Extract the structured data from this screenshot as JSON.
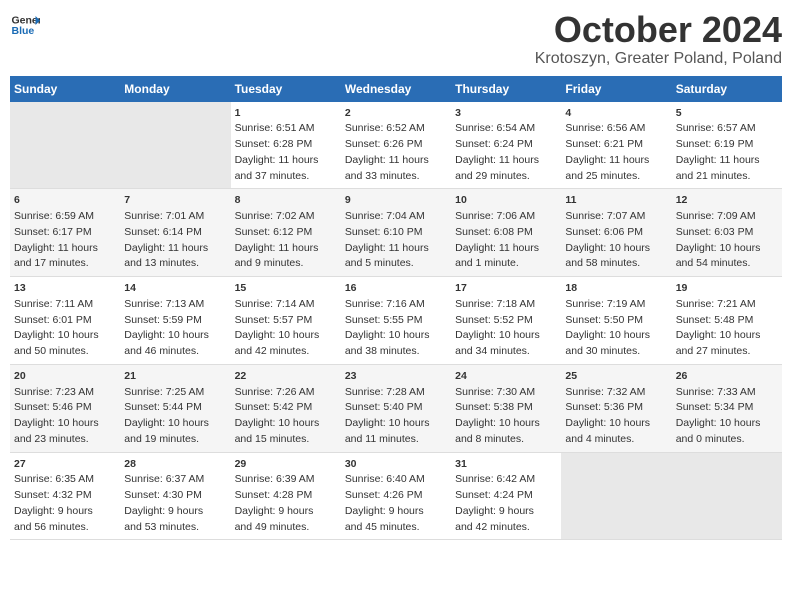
{
  "logo": {
    "general": "General",
    "blue": "Blue"
  },
  "header": {
    "month": "October 2024",
    "location": "Krotoszyn, Greater Poland, Poland"
  },
  "weekdays": [
    "Sunday",
    "Monday",
    "Tuesday",
    "Wednesday",
    "Thursday",
    "Friday",
    "Saturday"
  ],
  "weeks": [
    [
      {
        "day": "",
        "data": ""
      },
      {
        "day": "",
        "data": ""
      },
      {
        "day": "1",
        "data": "Sunrise: 6:51 AM\nSunset: 6:28 PM\nDaylight: 11 hours\nand 37 minutes."
      },
      {
        "day": "2",
        "data": "Sunrise: 6:52 AM\nSunset: 6:26 PM\nDaylight: 11 hours\nand 33 minutes."
      },
      {
        "day": "3",
        "data": "Sunrise: 6:54 AM\nSunset: 6:24 PM\nDaylight: 11 hours\nand 29 minutes."
      },
      {
        "day": "4",
        "data": "Sunrise: 6:56 AM\nSunset: 6:21 PM\nDaylight: 11 hours\nand 25 minutes."
      },
      {
        "day": "5",
        "data": "Sunrise: 6:57 AM\nSunset: 6:19 PM\nDaylight: 11 hours\nand 21 minutes."
      }
    ],
    [
      {
        "day": "6",
        "data": "Sunrise: 6:59 AM\nSunset: 6:17 PM\nDaylight: 11 hours\nand 17 minutes."
      },
      {
        "day": "7",
        "data": "Sunrise: 7:01 AM\nSunset: 6:14 PM\nDaylight: 11 hours\nand 13 minutes."
      },
      {
        "day": "8",
        "data": "Sunrise: 7:02 AM\nSunset: 6:12 PM\nDaylight: 11 hours\nand 9 minutes."
      },
      {
        "day": "9",
        "data": "Sunrise: 7:04 AM\nSunset: 6:10 PM\nDaylight: 11 hours\nand 5 minutes."
      },
      {
        "day": "10",
        "data": "Sunrise: 7:06 AM\nSunset: 6:08 PM\nDaylight: 11 hours\nand 1 minute."
      },
      {
        "day": "11",
        "data": "Sunrise: 7:07 AM\nSunset: 6:06 PM\nDaylight: 10 hours\nand 58 minutes."
      },
      {
        "day": "12",
        "data": "Sunrise: 7:09 AM\nSunset: 6:03 PM\nDaylight: 10 hours\nand 54 minutes."
      }
    ],
    [
      {
        "day": "13",
        "data": "Sunrise: 7:11 AM\nSunset: 6:01 PM\nDaylight: 10 hours\nand 50 minutes."
      },
      {
        "day": "14",
        "data": "Sunrise: 7:13 AM\nSunset: 5:59 PM\nDaylight: 10 hours\nand 46 minutes."
      },
      {
        "day": "15",
        "data": "Sunrise: 7:14 AM\nSunset: 5:57 PM\nDaylight: 10 hours\nand 42 minutes."
      },
      {
        "day": "16",
        "data": "Sunrise: 7:16 AM\nSunset: 5:55 PM\nDaylight: 10 hours\nand 38 minutes."
      },
      {
        "day": "17",
        "data": "Sunrise: 7:18 AM\nSunset: 5:52 PM\nDaylight: 10 hours\nand 34 minutes."
      },
      {
        "day": "18",
        "data": "Sunrise: 7:19 AM\nSunset: 5:50 PM\nDaylight: 10 hours\nand 30 minutes."
      },
      {
        "day": "19",
        "data": "Sunrise: 7:21 AM\nSunset: 5:48 PM\nDaylight: 10 hours\nand 27 minutes."
      }
    ],
    [
      {
        "day": "20",
        "data": "Sunrise: 7:23 AM\nSunset: 5:46 PM\nDaylight: 10 hours\nand 23 minutes."
      },
      {
        "day": "21",
        "data": "Sunrise: 7:25 AM\nSunset: 5:44 PM\nDaylight: 10 hours\nand 19 minutes."
      },
      {
        "day": "22",
        "data": "Sunrise: 7:26 AM\nSunset: 5:42 PM\nDaylight: 10 hours\nand 15 minutes."
      },
      {
        "day": "23",
        "data": "Sunrise: 7:28 AM\nSunset: 5:40 PM\nDaylight: 10 hours\nand 11 minutes."
      },
      {
        "day": "24",
        "data": "Sunrise: 7:30 AM\nSunset: 5:38 PM\nDaylight: 10 hours\nand 8 minutes."
      },
      {
        "day": "25",
        "data": "Sunrise: 7:32 AM\nSunset: 5:36 PM\nDaylight: 10 hours\nand 4 minutes."
      },
      {
        "day": "26",
        "data": "Sunrise: 7:33 AM\nSunset: 5:34 PM\nDaylight: 10 hours\nand 0 minutes."
      }
    ],
    [
      {
        "day": "27",
        "data": "Sunrise: 6:35 AM\nSunset: 4:32 PM\nDaylight: 9 hours\nand 56 minutes."
      },
      {
        "day": "28",
        "data": "Sunrise: 6:37 AM\nSunset: 4:30 PM\nDaylight: 9 hours\nand 53 minutes."
      },
      {
        "day": "29",
        "data": "Sunrise: 6:39 AM\nSunset: 4:28 PM\nDaylight: 9 hours\nand 49 minutes."
      },
      {
        "day": "30",
        "data": "Sunrise: 6:40 AM\nSunset: 4:26 PM\nDaylight: 9 hours\nand 45 minutes."
      },
      {
        "day": "31",
        "data": "Sunrise: 6:42 AM\nSunset: 4:24 PM\nDaylight: 9 hours\nand 42 minutes."
      },
      {
        "day": "",
        "data": ""
      },
      {
        "day": "",
        "data": ""
      }
    ]
  ]
}
